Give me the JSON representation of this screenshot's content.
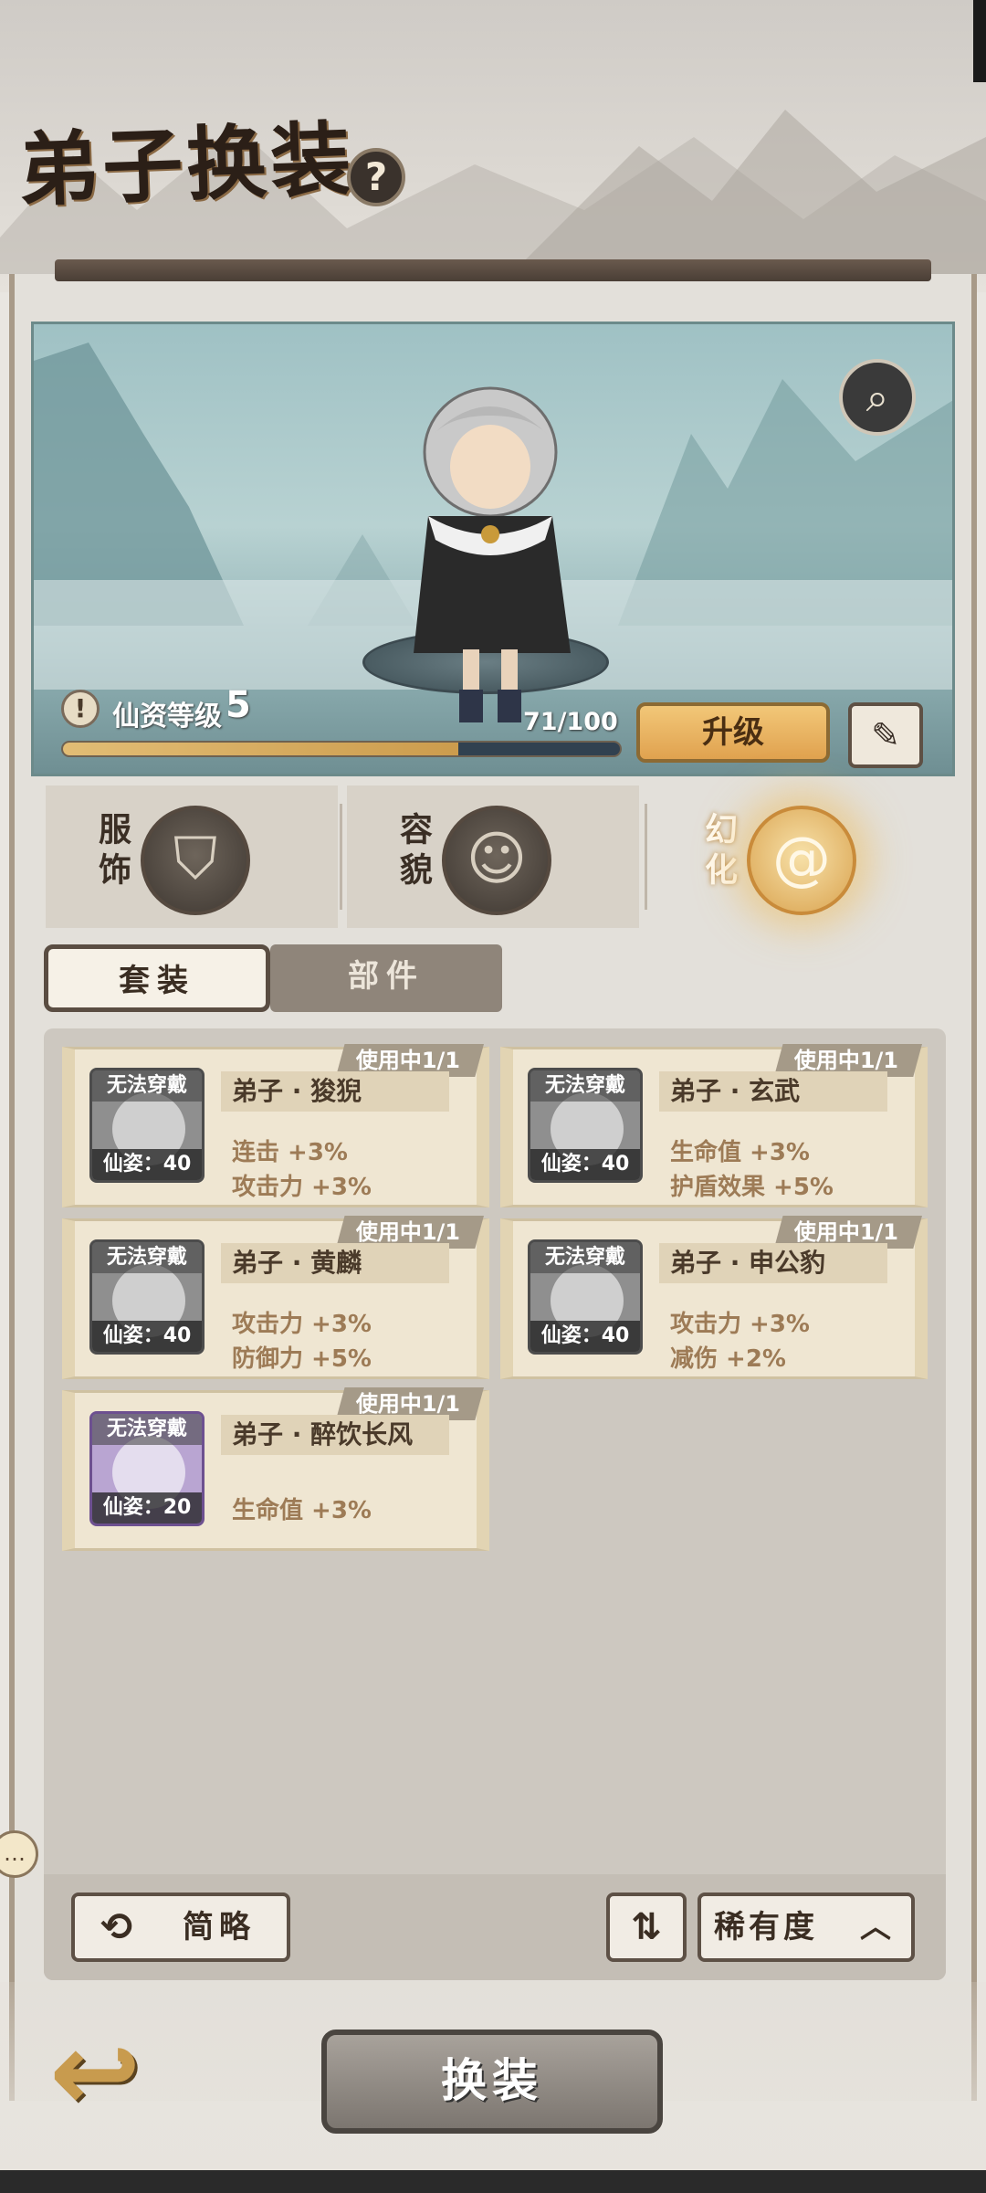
{
  "header": {
    "title": "弟子换装",
    "help_icon": "?"
  },
  "character": {
    "level_label": "仙资等级",
    "level": "5",
    "progress_text": "71/100",
    "progress": 0.71,
    "upgrade_label": "升级"
  },
  "categories": [
    {
      "label": "服饰",
      "icon": "robe-icon"
    },
    {
      "label": "容貌",
      "icon": "face-icon"
    },
    {
      "label": "幻化",
      "icon": "swirl-icon"
    }
  ],
  "subtabs": {
    "set": "套装",
    "parts": "部件"
  },
  "cards": [
    {
      "badge": "使用中1/1",
      "top": "无法穿戴",
      "bottom": "仙姿：40",
      "name": "弟子 · 狻猊",
      "stats": [
        "连击  +3%",
        "攻击力  +3%"
      ]
    },
    {
      "badge": "使用中1/1",
      "top": "无法穿戴",
      "bottom": "仙姿：40",
      "name": "弟子 · 玄武",
      "stats": [
        "生命值  +3%",
        "护盾效果  +5%"
      ]
    },
    {
      "badge": "使用中1/1",
      "top": "无法穿戴",
      "bottom": "仙姿：40",
      "name": "弟子 · 黄麟",
      "stats": [
        "攻击力  +3%",
        "防御力  +5%"
      ]
    },
    {
      "badge": "使用中1/1",
      "top": "无法穿戴",
      "bottom": "仙姿：40",
      "name": "弟子 · 申公豹",
      "stats": [
        "攻击力  +3%",
        "减伤  +2%"
      ]
    },
    {
      "badge": "使用中1/1",
      "top": "无法穿戴",
      "bottom": "仙姿：20",
      "name": "弟子 · 醉饮长风",
      "stats": [
        "生命值  +3%"
      ]
    }
  ],
  "controls": {
    "brief_label": "简略",
    "sort_label": "稀有度"
  },
  "footer": {
    "equip_label": "换装"
  }
}
